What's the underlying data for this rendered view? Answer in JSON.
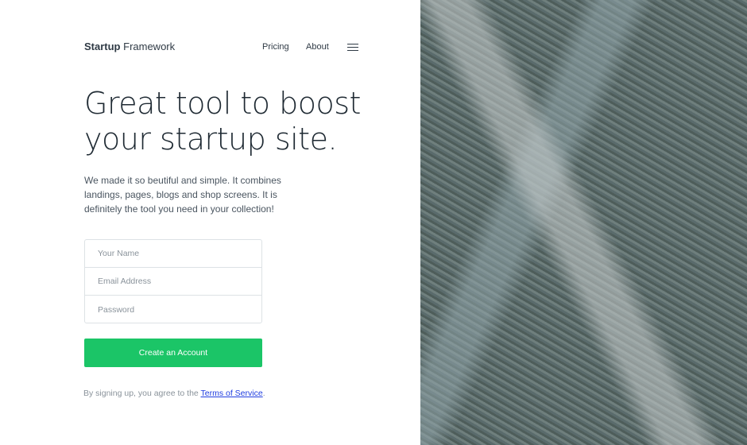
{
  "header": {
    "logo_bold": "Startup",
    "logo_rest": "Framework",
    "nav": [
      "Pricing",
      "About"
    ],
    "menu_icon": "hamburger-icon"
  },
  "hero": {
    "title_line1": "Great tool to boost",
    "title_line2": "your startup site.",
    "description": "We made it so beutiful and simple. It combines landings, pages, blogs and shop screens. It is definitely the tool you need in your collection!"
  },
  "form": {
    "name_placeholder": "Your Name",
    "email_placeholder": "Email Address",
    "password_placeholder": "Password",
    "submit_label": "Create an Account"
  },
  "terms": {
    "prefix": "By signing up, you agree to the",
    "link": "Terms of Service",
    "suffix": "."
  },
  "colors": {
    "accent": "#1bc567",
    "link": "#1f3de0",
    "text": "#2f3a45"
  }
}
